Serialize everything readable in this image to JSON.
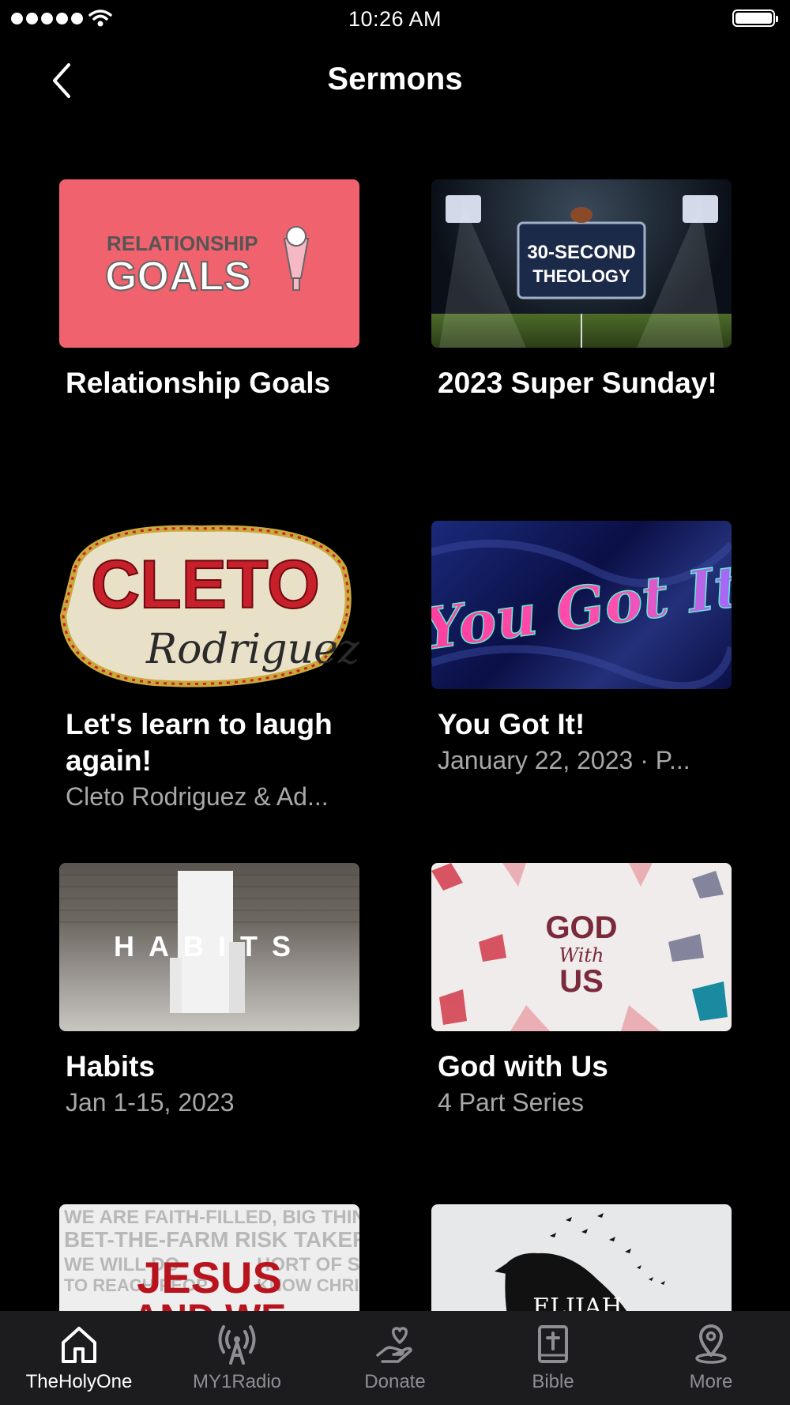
{
  "status": {
    "time": "10:26 AM"
  },
  "header": {
    "title": "Sermons"
  },
  "sermons": [
    {
      "title": "Relationship Goals",
      "subtitle": "",
      "art_text": [
        "RELATIONSHIP",
        "GOALS"
      ]
    },
    {
      "title": "2023 Super Sunday!",
      "subtitle": "",
      "art_text": [
        "30-SECOND",
        "THEOLOGY"
      ]
    },
    {
      "title": "Let's learn to laugh again!",
      "subtitle": "Cleto Rodriguez & Ad...",
      "art_text": [
        "CLETO",
        "Rodriguez"
      ]
    },
    {
      "title": "You Got It!",
      "subtitle": "January 22, 2023 · P...",
      "art_text": [
        "You Got It"
      ]
    },
    {
      "title": "Habits",
      "subtitle": "Jan 1-15, 2023",
      "art_text": [
        "HABITS"
      ]
    },
    {
      "title": "God with Us",
      "subtitle": "4 Part Series",
      "art_text": [
        "GOD",
        "With",
        "US"
      ]
    },
    {
      "title": "",
      "subtitle": "",
      "art_text": [
        "WE ARE FAITH-FILLED, BIG THINKING,",
        "BET-THE-FARM RISK TAKERS.",
        "WE WILL DO",
        "HORT OF SIN",
        "TO REACH PEOP",
        "KNOW CHRIST.",
        "JESUS",
        "AND WE"
      ]
    },
    {
      "title": "",
      "subtitle": "",
      "art_text": [
        "ELIJAH"
      ]
    }
  ],
  "tabs": [
    {
      "label": "TheHolyOne",
      "icon": "home-icon",
      "active": true
    },
    {
      "label": "MY1Radio",
      "icon": "radio-tower-icon",
      "active": false
    },
    {
      "label": "Donate",
      "icon": "donate-hand-heart-icon",
      "active": false
    },
    {
      "label": "Bible",
      "icon": "bible-icon",
      "active": false
    },
    {
      "label": "More",
      "icon": "location-pin-icon",
      "active": false
    }
  ],
  "colors": {
    "background": "#000000",
    "tabbar": "#1c1c1e",
    "inactive": "#8e8e93",
    "relationship_pink": "#f0626e"
  }
}
